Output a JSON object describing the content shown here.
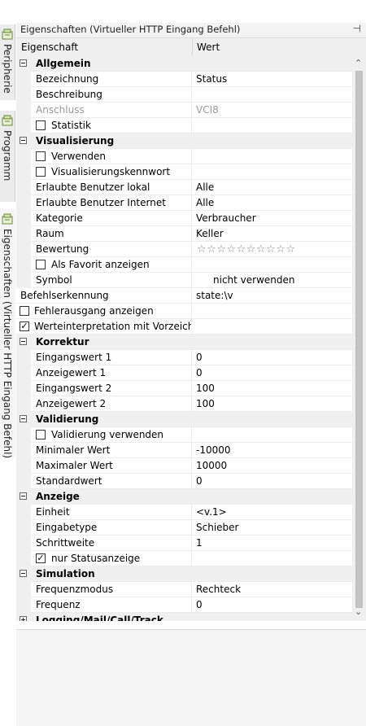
{
  "vtabs": [
    {
      "label": "Peripherie",
      "icon": "peripherie-icon"
    },
    {
      "label": "Programm",
      "icon": "program-icon"
    },
    {
      "label": "Eigenschaften (Virtueller HTTP Eingang Befehl)",
      "icon": "properties-icon"
    }
  ],
  "panel": {
    "title": "Eigenschaften (Virtueller HTTP Eingang Befehl)",
    "pin_glyph": "⊣",
    "col_property": "Eigenschaft",
    "col_value": "Wert"
  },
  "rows": [
    {
      "kind": "cat",
      "label": "Allgemein",
      "expanded": true
    },
    {
      "kind": "prop",
      "label": "Bezeichnung",
      "value": "Status"
    },
    {
      "kind": "prop",
      "label": "Beschreibung",
      "value": ""
    },
    {
      "kind": "prop",
      "label": "Anschluss",
      "value": "VCI8",
      "disabled": true
    },
    {
      "kind": "check",
      "label": "Statistik",
      "checked": false
    },
    {
      "kind": "cat",
      "label": "Visualisierung",
      "expanded": true
    },
    {
      "kind": "check",
      "label": "Verwenden",
      "checked": false
    },
    {
      "kind": "check",
      "label": "Visualisierungskennwort",
      "checked": false
    },
    {
      "kind": "prop",
      "label": "Erlaubte Benutzer lokal",
      "value": "Alle"
    },
    {
      "kind": "prop",
      "label": "Erlaubte Benutzer Internet",
      "value": "Alle"
    },
    {
      "kind": "prop",
      "label": "Kategorie",
      "value": "Verbraucher"
    },
    {
      "kind": "prop",
      "label": "Raum",
      "value": "Keller"
    },
    {
      "kind": "stars",
      "label": "Bewertung",
      "stars": 10
    },
    {
      "kind": "check",
      "label": "Als Favorit anzeigen",
      "checked": false
    },
    {
      "kind": "prop",
      "label": "Symbol",
      "value": "nicht verwenden",
      "value_indent": true
    },
    {
      "kind": "top",
      "label": "Befehlserkennung",
      "value": "state:\\v"
    },
    {
      "kind": "topcheck",
      "label": "Fehlerausgang anzeigen",
      "checked": false
    },
    {
      "kind": "topcheck",
      "label": "Werteinterpretation mit Vorzeichen",
      "checked": true
    },
    {
      "kind": "cat",
      "label": "Korrektur",
      "expanded": true
    },
    {
      "kind": "prop",
      "label": "Eingangswert 1",
      "value": "0"
    },
    {
      "kind": "prop",
      "label": "Anzeigewert 1",
      "value": "0"
    },
    {
      "kind": "prop",
      "label": "Eingangswert 2",
      "value": "100"
    },
    {
      "kind": "prop",
      "label": "Anzeigewert 2",
      "value": "100"
    },
    {
      "kind": "cat",
      "label": "Validierung",
      "expanded": true
    },
    {
      "kind": "check",
      "label": "Validierung verwenden",
      "checked": false
    },
    {
      "kind": "prop",
      "label": "Minimaler Wert",
      "value": "-10000"
    },
    {
      "kind": "prop",
      "label": "Maximaler Wert",
      "value": "10000"
    },
    {
      "kind": "prop",
      "label": "Standardwert",
      "value": "0"
    },
    {
      "kind": "cat",
      "label": "Anzeige",
      "expanded": true
    },
    {
      "kind": "prop",
      "label": "Einheit",
      "value": "<v.1>"
    },
    {
      "kind": "prop",
      "label": "Eingabetype",
      "value": "Schieber"
    },
    {
      "kind": "prop",
      "label": "Schrittweite",
      "value": "1"
    },
    {
      "kind": "check",
      "label": "nur Statusanzeige",
      "checked": true
    },
    {
      "kind": "cat",
      "label": "Simulation",
      "expanded": true
    },
    {
      "kind": "prop",
      "label": "Frequenzmodus",
      "value": "Rechteck"
    },
    {
      "kind": "prop",
      "label": "Frequenz",
      "value": "0"
    },
    {
      "kind": "cat",
      "label": "Logging/Mail/Call/Track",
      "expanded": false
    }
  ],
  "glyphs": {
    "check": "✓",
    "star": "☆",
    "scroll_up": "⌃",
    "scroll_down": "⌄"
  },
  "colors": {
    "gutter": "#f0f0f0",
    "disabled_text": "#9a9a9a",
    "tab_bg": "#ececec"
  }
}
